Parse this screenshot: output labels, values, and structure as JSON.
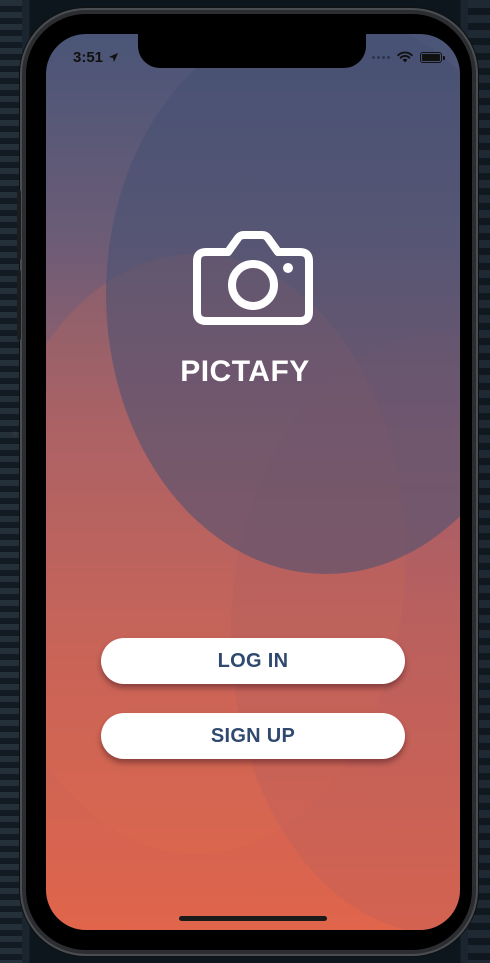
{
  "status_bar": {
    "time": "3:51",
    "location_icon": "location-arrow-icon",
    "wifi_icon": "wifi-icon",
    "battery_icon": "battery-icon"
  },
  "app": {
    "logo_icon": "camera-icon",
    "name": "PICTAFY"
  },
  "actions": {
    "login_label": "LOG IN",
    "signup_label": "SIGN UP"
  },
  "colors": {
    "gradient_top": "#4a5577",
    "gradient_bottom": "#e0654b",
    "button_bg": "#ffffff",
    "button_text": "#2f4a6e"
  }
}
